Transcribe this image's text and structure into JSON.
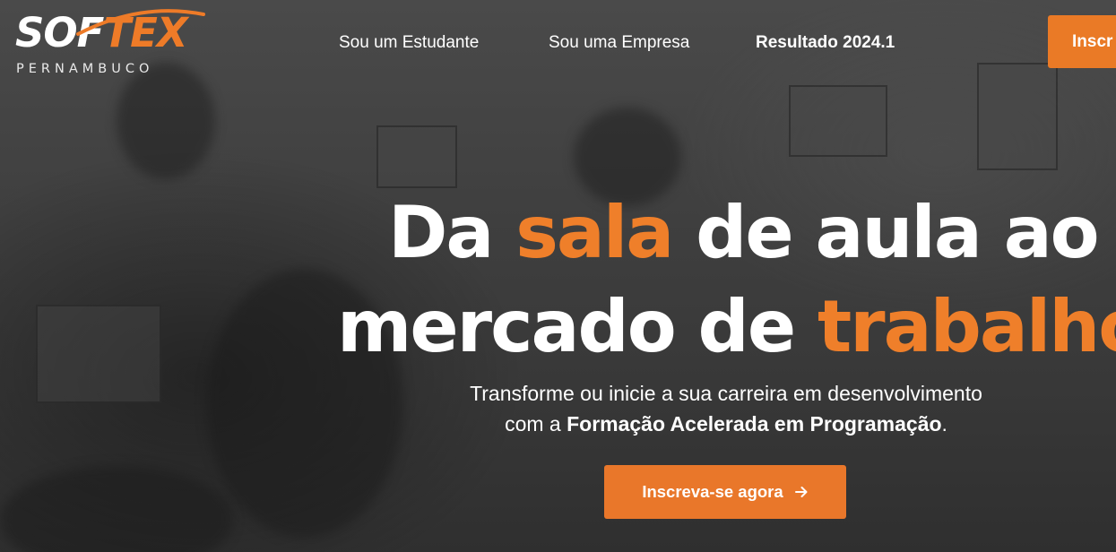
{
  "logo": {
    "text_main": "SOF",
    "text_accent": "TEX",
    "subtitle": "PERNAMBUCO"
  },
  "nav": {
    "student": "Sou um Estudante",
    "company": "Sou uma Empresa",
    "result": "Resultado 2024.1",
    "signup_button": "Inscr"
  },
  "hero": {
    "title_line1_part1": "Da ",
    "title_line1_accent": "sala",
    "title_line1_part2": " de aula ao",
    "title_line2_part1": "mercado de ",
    "title_line2_accent": "trabalho",
    "subtitle_line1": "Transforme ou inicie a sua carreira em desenvolvimento",
    "subtitle_line2_prefix": "com a ",
    "subtitle_line2_bold": "Formação Acelerada em Programação",
    "subtitle_line2_suffix": ".",
    "cta_label": "Inscreva-se agora",
    "cta_icon": "arrow-right-icon"
  },
  "colors": {
    "accent": "#ef7f2a",
    "button": "#e9772a",
    "text": "#ffffff",
    "background": "#3f3f3f"
  }
}
